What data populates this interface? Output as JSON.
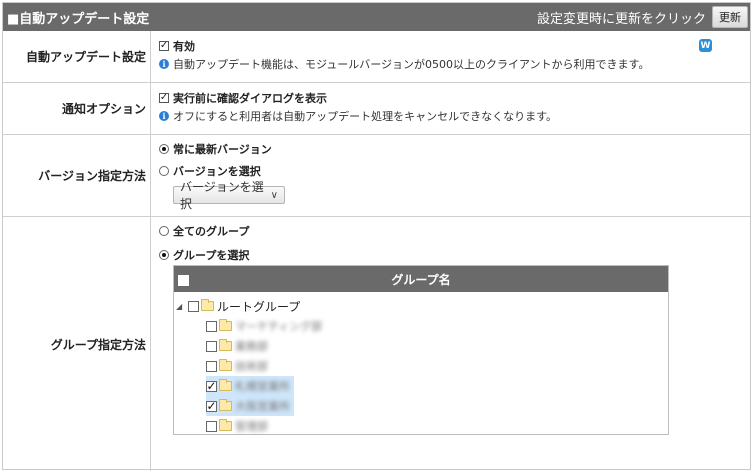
{
  "header": {
    "title": "■自動アップデート設定",
    "hint": "設定変更時に更新をクリック",
    "update_button": "更新"
  },
  "rows": {
    "auto_update": {
      "label": "自動アップデート設定",
      "checkbox_label": "有効",
      "checked": true,
      "info": "自動アップデート機能は、モジュールバージョンが0500以上のクライアントから利用できます。",
      "help_badge": "W"
    },
    "notify": {
      "label": "通知オプション",
      "checkbox_label": "実行前に確認ダイアログを表示",
      "checked": true,
      "info": "オフにすると利用者は自動アップデート処理をキャンセルできなくなります。"
    },
    "version": {
      "label": "バージョン指定方法",
      "options": [
        "常に最新バージョン",
        "バージョンを選択"
      ],
      "selected": "常に最新バージョン",
      "select_value": "バージョンを選択"
    },
    "group": {
      "label": "グループ指定方法",
      "options": [
        "全てのグループ",
        "グループを選択"
      ],
      "selected": "グループを選択",
      "table_header": "グループ名",
      "root": "ルートグループ",
      "children": [
        {
          "name": "マーケティング部",
          "checked": false
        },
        {
          "name": "業務部",
          "checked": false
        },
        {
          "name": "技術部",
          "checked": false
        },
        {
          "name": "札幌営業所",
          "checked": true
        },
        {
          "name": "大阪営業所",
          "checked": true
        },
        {
          "name": "管理部",
          "checked": false
        }
      ]
    }
  },
  "colors": {
    "header_bg": "#6a6a6a",
    "info_icon": "#2b7ed8",
    "selected_row": "#cfe6fa",
    "folder": "#fde9a8"
  }
}
